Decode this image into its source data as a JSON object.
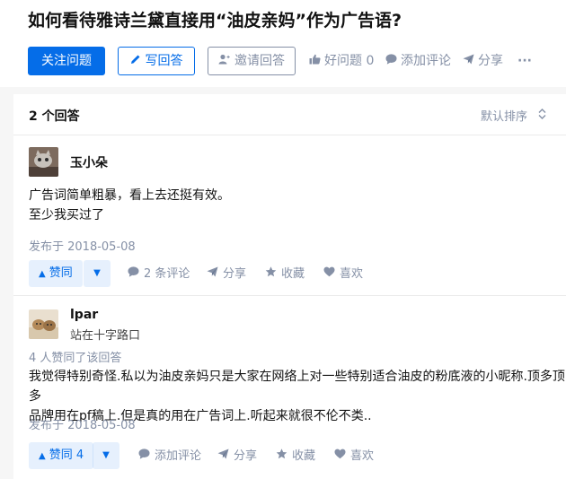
{
  "question": {
    "title": "如何看待雅诗兰黛直接用“油皮亲妈”作为广告语?",
    "follow_label": "关注问题",
    "write_label": "写回答",
    "invite_label": "邀请回答",
    "good_question_label": "好问题 0",
    "add_comment_label": "添加评论",
    "share_label": "分享",
    "more_label": "···"
  },
  "answers_header": {
    "count_label": "2 个回答",
    "sort_label": "默认排序"
  },
  "answers": [
    {
      "author": "玉小朵",
      "content_lines": [
        "广告词简单粗暴，看上去还挺有效。",
        "至少我买过了"
      ],
      "date": "发布于 2018-05-08",
      "vote_label": "赞同",
      "comment_label": "2 条评论",
      "share_label": "分享",
      "collect_label": "收藏",
      "like_label": "喜欢"
    },
    {
      "author": "lpar",
      "bio": "站在十字路口",
      "voters": "4 人赞同了该回答",
      "content_lines": [
        "我觉得特别奇怪.私以为油皮亲妈只是大家在网络上对一些特别适合油皮的粉底液的小昵称.顶多顶多",
        "品牌用在pf稿上.但是真的用在广告词上.听起来就很不伦不类.."
      ],
      "date": "发布于 2018-05-08",
      "vote_label": "赞同 4",
      "comment_label": "添加评论",
      "share_label": "分享",
      "collect_label": "收藏",
      "like_label": "喜欢"
    }
  ],
  "colors": {
    "brand_blue": "#056de8",
    "meta_gray": "#8590a6",
    "page_bg": "#f6f6f6"
  },
  "icons": {
    "write": "pencil-icon",
    "invite": "add-user-icon",
    "good_question": "thumb-up-icon",
    "comment": "comment-bubble-icon",
    "share": "paper-plane-icon",
    "collect": "star-icon",
    "like": "heart-icon",
    "vote_up": "triangle-up-icon",
    "vote_down": "triangle-down-icon",
    "sort": "sort-chevrons-icon"
  }
}
